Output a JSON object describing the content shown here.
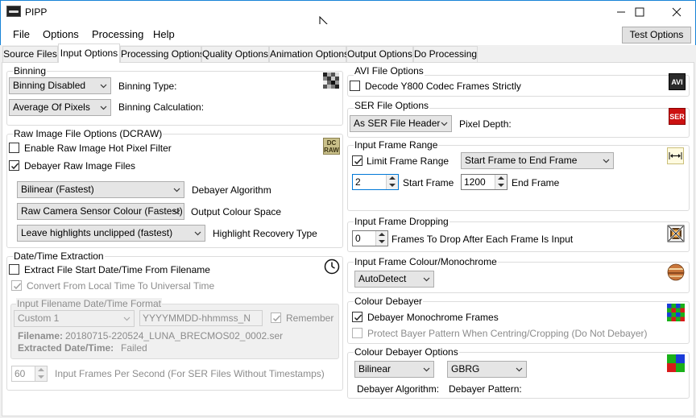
{
  "window": {
    "title": "PIPP",
    "minimize": "—",
    "maximize": "☐",
    "close": "✕"
  },
  "menu": {
    "file": "File",
    "options": "Options",
    "processing": "Processing",
    "help": "Help",
    "test_options": "Test Options"
  },
  "tabs": [
    "Source Files",
    "Input Options",
    "Processing Options",
    "Quality Options",
    "Animation Options",
    "Output Options",
    "Do Processing"
  ],
  "binning": {
    "title": "Binning",
    "type_value": "Binning Disabled",
    "type_label": "Binning Type:",
    "calc_value": "Average Of Pixels",
    "calc_label": "Binning Calculation:"
  },
  "raw": {
    "title": "Raw Image File Options (DCRAW)",
    "hot_pixel_label": "Enable Raw Image Hot Pixel Filter",
    "hot_pixel_checked": false,
    "debayer_label": "Debayer Raw Image Files",
    "debayer_checked": true,
    "algorithm_value": "Bilinear (Fastest)",
    "algorithm_label": "Debayer Algorithm",
    "colour_value": "Raw Camera Sensor Colour (Fastest)",
    "colour_label": "Output Colour Space",
    "highlight_value": "Leave highlights unclipped (fastest)",
    "highlight_label": "Highlight Recovery Type",
    "icon_text_top": "DC",
    "icon_text_bottom": "RAW"
  },
  "datetime": {
    "title": "Date/Time Extraction",
    "extract_label": "Extract File Start Date/Time From Filename",
    "convert_label": "Convert From Local Time To Universal Time",
    "format_title": "Input Filename Date/Time Format",
    "format_value": "Custom 1",
    "format_text": "YYYYMMDD-hhmmss_N",
    "remember_label": "Remember",
    "filename_label": "Filename:",
    "filename_value": "20180715-220524_LUNA_BRECMOS02_0002.ser",
    "extracted_label": "Extracted Date/Time:",
    "extracted_value": "Failed",
    "fps_value": "60",
    "fps_label": "Input Frames Per Second (For SER Files Without Timestamps)"
  },
  "avi": {
    "title": "AVI File Options",
    "decode_label": "Decode Y800 Codec Frames Strictly",
    "icon_text": "AVI"
  },
  "ser": {
    "title": "SER File Options",
    "depth_value": "As SER File Header",
    "depth_label": "Pixel Depth:",
    "icon_text": "SER"
  },
  "frame_range": {
    "title": "Input Frame Range",
    "limit_label": "Limit Frame Range",
    "limit_checked": true,
    "range_value": "Start Frame to End Frame",
    "start_value": "2",
    "start_label": "Start Frame",
    "end_value": "1200",
    "end_label": "End Frame"
  },
  "dropping": {
    "title": "Input Frame Dropping",
    "value": "0",
    "label": "Frames To Drop After Each Frame Is Input"
  },
  "colour_mono": {
    "title": "Input Frame Colour/Monochrome",
    "value": "AutoDetect"
  },
  "colour_debayer": {
    "title": "Colour Debayer",
    "mono_label": "Debayer Monochrome Frames",
    "mono_checked": true,
    "protect_label": "Protect Bayer Pattern When Centring/Cropping (Do Not Debayer)"
  },
  "debayer_options": {
    "title": "Colour Debayer Options",
    "algorithm_value": "Bilinear",
    "pattern_value": "GBRG",
    "algorithm_label": "Debayer Algorithm:",
    "pattern_label": "Debayer Pattern:"
  },
  "colors": {
    "accent_border": "#1883d7",
    "ser_icon": "#cc1111"
  }
}
